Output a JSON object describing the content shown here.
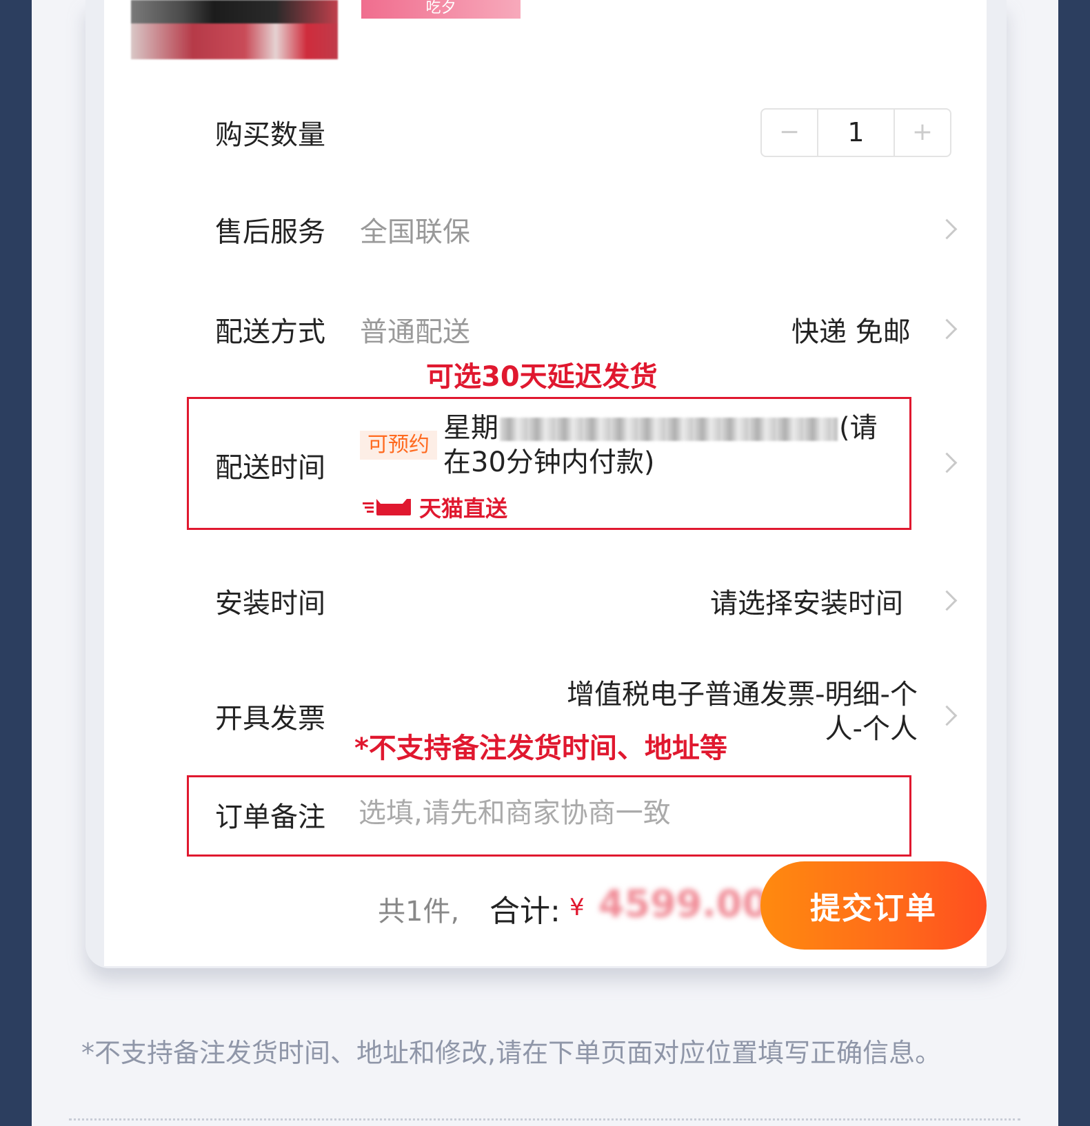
{
  "product": {
    "promo_badge": "吃夕"
  },
  "quantity": {
    "label": "购买数量",
    "minus": "−",
    "value": "1",
    "plus": "+"
  },
  "after_sales": {
    "label": "售后服务",
    "value": "全国联保"
  },
  "shipping_method": {
    "label": "配送方式",
    "value": "普通配送",
    "right_value": "快递 免邮"
  },
  "delay_callout": "可选30天延迟发货",
  "delivery_time": {
    "label": "配送时间",
    "tag": "可预约",
    "weekday": "星期",
    "suffix": "(请在30分钟内付款)",
    "tmall_label": "天猫直送"
  },
  "install_time": {
    "label": "安装时间",
    "value": "请选择安装时间"
  },
  "invoice": {
    "label": "开具发票",
    "value": "增值税电子普通发票-明细-个人-个人"
  },
  "remark_callout": "*不支持备注发货时间、地址等",
  "order_remark": {
    "label": "订单备注",
    "placeholder": "选填,请先和商家协商一致"
  },
  "footer": {
    "count": "共1件,",
    "total_label": "合计:",
    "currency": "¥",
    "price": "4599.00",
    "submit": "提交订单"
  },
  "footnote": "*不支持备注发货时间、地址和修改,请在下单页面对应位置填写正确信息。",
  "colors": {
    "accent_red": "#e0182f",
    "orange": "#ff6a1a",
    "background": "#2c3e5f"
  }
}
